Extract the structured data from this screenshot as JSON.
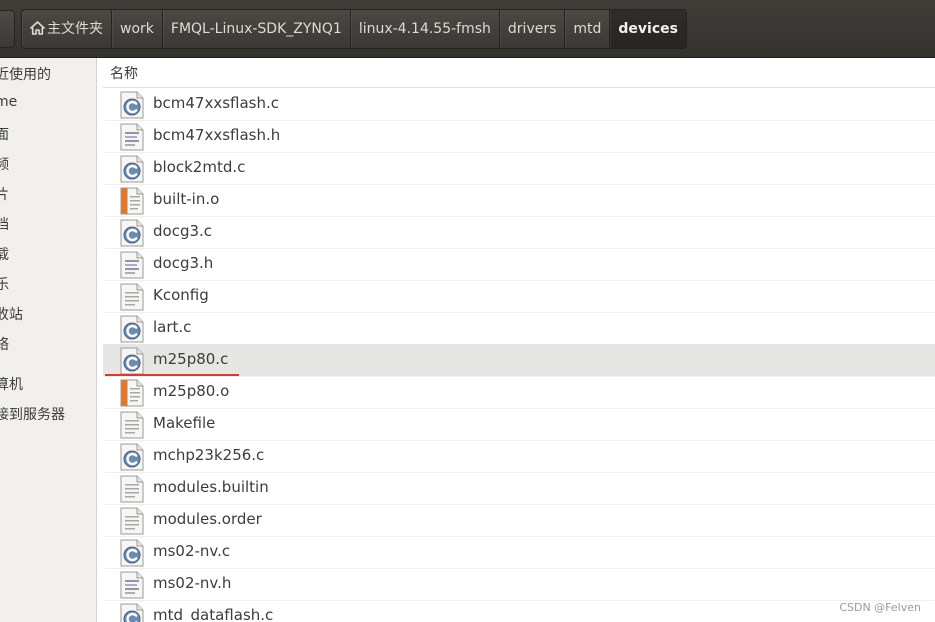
{
  "breadcrumbs": [
    {
      "label": "主文件夹",
      "icon": "home-icon"
    },
    {
      "label": "work"
    },
    {
      "label": "FMQL-Linux-SDK_ZYNQ1"
    },
    {
      "label": "linux-4.14.55-fmsh"
    },
    {
      "label": "drivers"
    },
    {
      "label": "mtd"
    },
    {
      "label": "devices",
      "active": true
    }
  ],
  "sidebar": {
    "items": [
      "近使用的",
      "me",
      "面",
      "频",
      "片",
      "档",
      "载",
      "乐",
      "收站",
      "络",
      "算机",
      "接到服务器"
    ]
  },
  "file_list": {
    "column_header": "名称",
    "files": [
      {
        "name": "bcm47xxsflash.c",
        "type": "c-source"
      },
      {
        "name": "bcm47xxsflash.h",
        "type": "header"
      },
      {
        "name": "block2mtd.c",
        "type": "c-source"
      },
      {
        "name": "built-in.o",
        "type": "object"
      },
      {
        "name": "docg3.c",
        "type": "c-source"
      },
      {
        "name": "docg3.h",
        "type": "header"
      },
      {
        "name": "Kconfig",
        "type": "text"
      },
      {
        "name": "lart.c",
        "type": "c-source"
      },
      {
        "name": "m25p80.c",
        "type": "c-source",
        "selected": true
      },
      {
        "name": "m25p80.o",
        "type": "object"
      },
      {
        "name": "Makefile",
        "type": "text"
      },
      {
        "name": "mchp23k256.c",
        "type": "c-source"
      },
      {
        "name": "modules.builtin",
        "type": "text"
      },
      {
        "name": "modules.order",
        "type": "text"
      },
      {
        "name": "ms02-nv.c",
        "type": "c-source"
      },
      {
        "name": "ms02-nv.h",
        "type": "header"
      },
      {
        "name": "mtd_dataflash.c",
        "type": "c-source"
      }
    ]
  },
  "watermark": "CSDN @Felven",
  "colors": {
    "header_bg": "#3c3b37",
    "active_crumb_bg": "#2b2a27",
    "sidebar_bg": "#f1f0ee",
    "selected_row_bg": "#e6e6e4",
    "annotation_red": "#d63b30",
    "c_icon_blue": "#4e6f96",
    "object_icon_orange": "#e0782b"
  }
}
